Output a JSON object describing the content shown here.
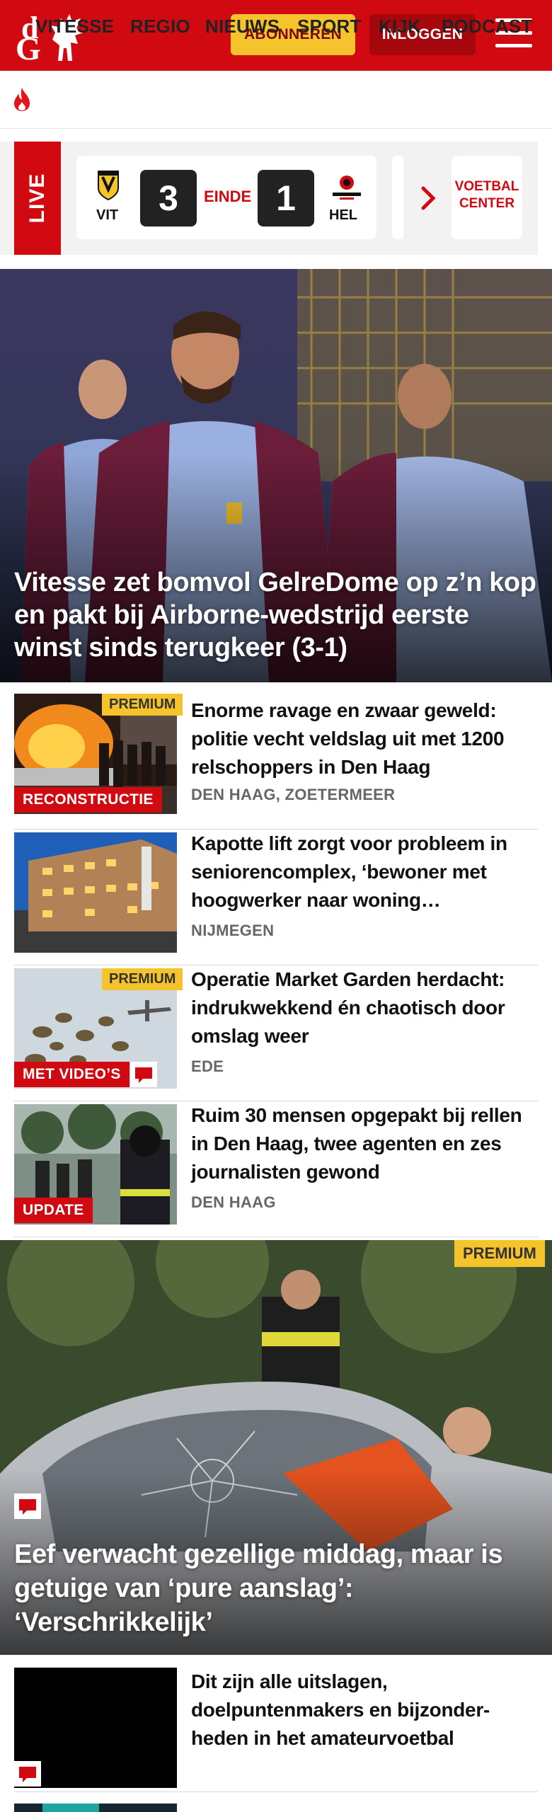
{
  "header": {
    "logo_top": "d",
    "logo_bottom": "G",
    "subscribe_label": "ABONNEREN",
    "login_label": "INLOGGEN",
    "brand_color": "#d10a11",
    "accent_color": "#f5c32c"
  },
  "nav": {
    "items": [
      {
        "label": "VITESSE",
        "icon": "flame-icon"
      },
      {
        "label": "REGIO"
      },
      {
        "label": "NIEUWS"
      },
      {
        "label": "SPORT"
      },
      {
        "label": "KIJK"
      },
      {
        "label": "PODCAST"
      }
    ]
  },
  "live": {
    "tag": "LIVE",
    "home_team": "VIT",
    "home_score": "3",
    "status": "EINDE",
    "away_score": "1",
    "away_team": "HEL",
    "away_logo_text": "HELMOND SPORT",
    "voetbalcenter_line1": "VOETBAL",
    "voetbalcenter_line2": "CENTER"
  },
  "hero": {
    "headline": "Vitesse zet bomvol GelreDome op z’n kop en pakt bij Airborne-wedstrijd eerste winst sinds terugkeer (3-1)"
  },
  "articles": [
    {
      "title": "Enorme ravage en zwaar geweld: politie vecht veldslag uit met 1200 relschoppers in Den Haag",
      "location": "DEN HAAG, ZOETERMEER",
      "premium": "PREMIUM",
      "label": "RECONSTRUCTIE"
    },
    {
      "title": "Kapotte lift zorgt voor probleem in seniorencomplex, ‘bewoner met hoogwerker naar woning…",
      "location": "NIJMEGEN"
    },
    {
      "title": "Operatie Market Garden herdacht: indrukwekkend én chaotisch door omslag weer",
      "location": "EDE",
      "premium": "PREMIUM",
      "label": "MET VIDEO’S"
    },
    {
      "title": "Ruim 30 mensen opgepakt bij rellen in Den Haag, twee agenten en zes journalisten gewond",
      "location": "DEN HAAG",
      "label": "UPDATE"
    }
  ],
  "hero2": {
    "premium": "PREMIUM",
    "headline": "Eef verwacht gezellige middag, maar is getuige van ‘pure aanslag’: ‘Verschrikkelijk’"
  },
  "article5": {
    "title": "Dit zijn alle uitslagen, doelpuntenmakers en bijzonder-heden in het amateurvoetbal"
  }
}
